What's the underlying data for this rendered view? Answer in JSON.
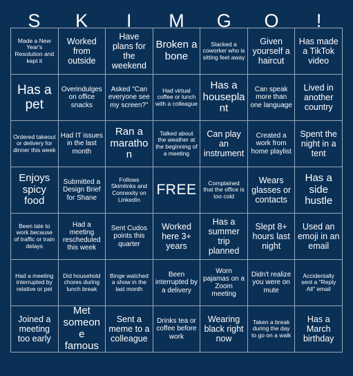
{
  "card": {
    "title_letters": [
      "S",
      "K",
      "I",
      "M",
      "G",
      "O",
      "!"
    ],
    "colors": {
      "background": "#0b3056",
      "cell_background": "#0b3056",
      "border": "#9aa9b8",
      "text": "#ffffff"
    },
    "columns": 7,
    "rows": 7,
    "free_space_label": "FREE",
    "squares": [
      [
        "Made a New Year's Resolution and kept it",
        "Worked from outside",
        "Have plans for the weekend",
        "Broken a bone",
        "Slacked a coworker who is sitting feet away",
        "Given yourself a haircut",
        "Has made a TikTok video"
      ],
      [
        "Has a pet",
        "Overindulges on office snacks",
        "Asked \"Can everyone see my screen?\"",
        "Had virtual coffee or lunch with a colleague",
        "Has a houseplant",
        "Can speak more than one language",
        "Lived in another country"
      ],
      [
        "Ordered takeout or delivery for dinner this week",
        "Had IT issues in the last month",
        "Ran a marathon",
        "Talked about the weather at the beginning of a meeting",
        "Can play an instrument",
        "Created a work from home playlist",
        "Spent the night in a tent"
      ],
      [
        "Enjoys spicy food",
        "Submitted a Design Brief for Shane",
        "Follows Skimlinks and Connexity on LinkedIn",
        "FREE",
        "Complained that the office is too cold",
        "Wears glasses or contacts",
        "Has a side hustle"
      ],
      [
        "Been late to work because of traffic or train delays",
        "Had a meeting rescheduled this week",
        "Sent Cudos points this quarter",
        "Worked here 3+ years",
        "Has a summer trip planned",
        "Slept 8+ hours last night",
        "Used an emoji in an email"
      ],
      [
        "Had a meeting interrupted by relative or pet",
        "Did household chores during lunch break",
        "Binge watched a show in the last month",
        "Been interrupted by a delivery",
        "Worn pajamas on a Zoom meeting",
        "Didn't realize you were on mute",
        "Accidentally sent a \"Reply All\" email"
      ],
      [
        "Joined a meeting too early",
        "Met someone famous",
        "Sent a meme to a colleague",
        "Drinks tea or coffee before work",
        "Wearing black right now",
        "Taken a break during the day to go on a walk",
        "Has a March birthday"
      ]
    ]
  }
}
